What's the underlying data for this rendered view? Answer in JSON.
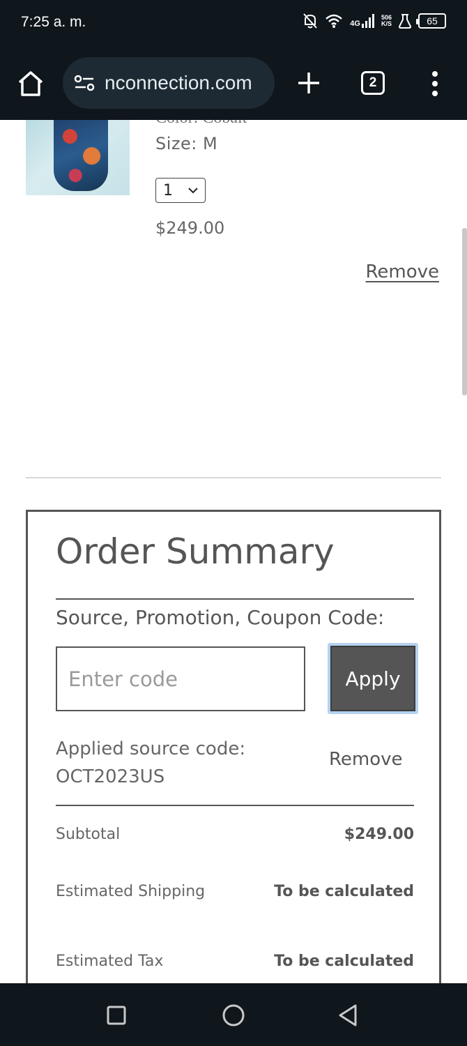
{
  "status": {
    "time": "7:25 a. m.",
    "network": "4G",
    "speed_top": "506",
    "speed_bottom": "K/S",
    "battery": "65"
  },
  "browser": {
    "url": "nconnection.com",
    "tab_count": "2"
  },
  "product": {
    "color_line": "Color:  Cobalt",
    "size_line": "Size:  M",
    "quantity": "1",
    "price": "$249.00",
    "remove_label": "Remove"
  },
  "summary": {
    "title": "Order Summary",
    "promo_label": "Source, Promotion, Coupon Code:",
    "code_placeholder": "Enter code",
    "apply_label": "Apply",
    "applied_label": "Applied source code:",
    "applied_code": "OCT2023US",
    "applied_remove": "Remove",
    "rows": [
      {
        "label": "Subtotal",
        "value": "$249.00"
      },
      {
        "label": "Estimated Shipping",
        "value": "To be calculated"
      },
      {
        "label": "Estimated Tax",
        "value": "To be calculated"
      }
    ]
  },
  "icons": {
    "home": "home-icon",
    "site_settings": "tune-icon",
    "new_tab": "plus-icon",
    "menu": "more-vert-icon",
    "nav_recent": "square-icon",
    "nav_home": "circle-icon",
    "nav_back": "triangle-back-icon"
  }
}
